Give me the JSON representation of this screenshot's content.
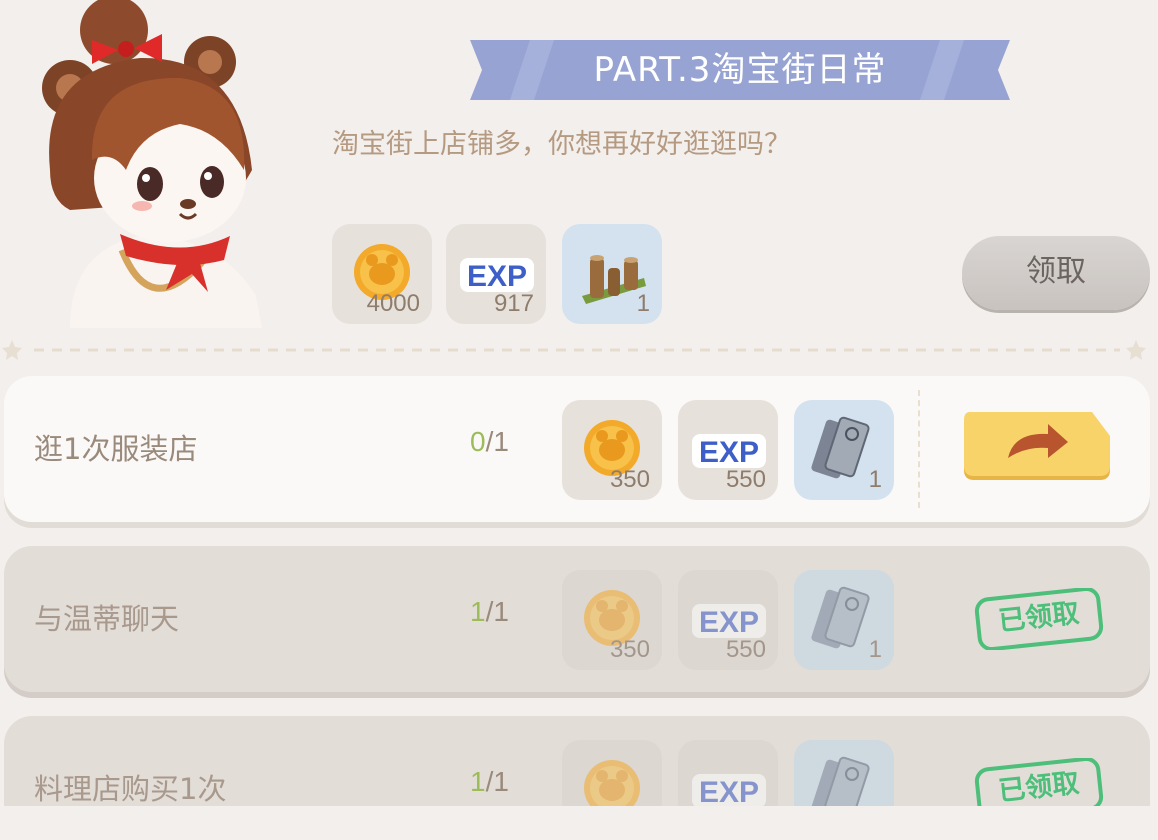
{
  "part": {
    "title": "PART.3淘宝街日常",
    "description": "淘宝街上店铺多，你想再好好逛逛吗？",
    "claim_label": "领取",
    "rewards": [
      {
        "icon": "coin-icon",
        "amount": "4000"
      },
      {
        "icon": "exp-icon",
        "amount": "917"
      },
      {
        "icon": "wooden-fence-icon",
        "amount": "1"
      }
    ]
  },
  "tasks": [
    {
      "name": "逛1次服装店",
      "progress_current": "0",
      "progress_total": "/1",
      "status": "in-progress",
      "rewards": [
        {
          "icon": "coin-icon",
          "amount": "350"
        },
        {
          "icon": "exp-icon",
          "amount": "550"
        },
        {
          "icon": "ticket-icon",
          "amount": "1"
        }
      ]
    },
    {
      "name": "与温蒂聊天",
      "progress_current": "1",
      "progress_total": "/1",
      "status": "claimed",
      "status_label": "已领取",
      "rewards": [
        {
          "icon": "coin-icon",
          "amount": "350"
        },
        {
          "icon": "exp-icon",
          "amount": "550"
        },
        {
          "icon": "ticket-icon",
          "amount": "1"
        }
      ]
    },
    {
      "name": "料理店购买1次",
      "progress_current": "1",
      "progress_total": "/1",
      "status": "claimed",
      "status_label": "已领取",
      "rewards": [
        {
          "icon": "coin-icon",
          "amount": ""
        },
        {
          "icon": "exp-icon",
          "amount": ""
        },
        {
          "icon": "ticket-icon",
          "amount": ""
        }
      ]
    }
  ],
  "colors": {
    "banner": "#97a4d3",
    "go_button": "#f7d36a",
    "stamp": "#4dbf7a",
    "progress_current": "#9cbc5a"
  }
}
